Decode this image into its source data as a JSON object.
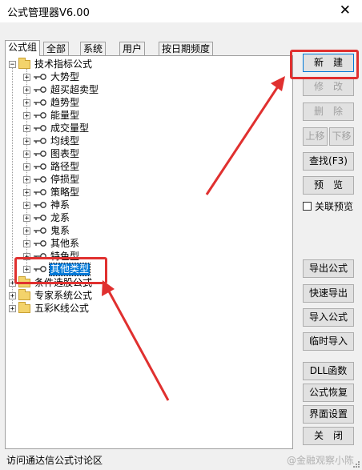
{
  "window": {
    "title": "公式管理器V6.00"
  },
  "tabs": [
    {
      "label": "公式组"
    },
    {
      "label": "全部"
    },
    {
      "label": "系统"
    },
    {
      "label": "用户"
    },
    {
      "label": "按日期频度"
    }
  ],
  "tree": {
    "root": "技术指标公式",
    "children": [
      "大势型",
      "超买超卖型",
      "趋势型",
      "能量型",
      "成交量型",
      "均线型",
      "图表型",
      "路径型",
      "停损型",
      "策略型",
      "神系",
      "龙系",
      "鬼系",
      "其他系",
      "特色型",
      "其他类型"
    ],
    "selected": "其他类型",
    "siblings": [
      "条件选股公式",
      "专家系统公式",
      "五彩K线公式"
    ]
  },
  "buttons": {
    "new": "新　建",
    "modify": "修　改",
    "delete": "删　除",
    "move_up": "上移",
    "move_down": "下移",
    "find": "查找(F3)",
    "preview": "预　览",
    "export": "导出公式",
    "quick_export": "快速导出",
    "import": "导入公式",
    "temp_import": "临时导入",
    "dll": "DLL函数",
    "restore": "公式恢复",
    "ui_settings": "界面设置",
    "close": "关　闭"
  },
  "checkbox": {
    "related_preview": "关联预览",
    "checked": false
  },
  "status": {
    "text": "访问通达信公式讨论区"
  },
  "watermark": "@金融观察小陈",
  "colors": {
    "annotation_red": "#e0302f",
    "selection_blue": "#0078d7"
  }
}
